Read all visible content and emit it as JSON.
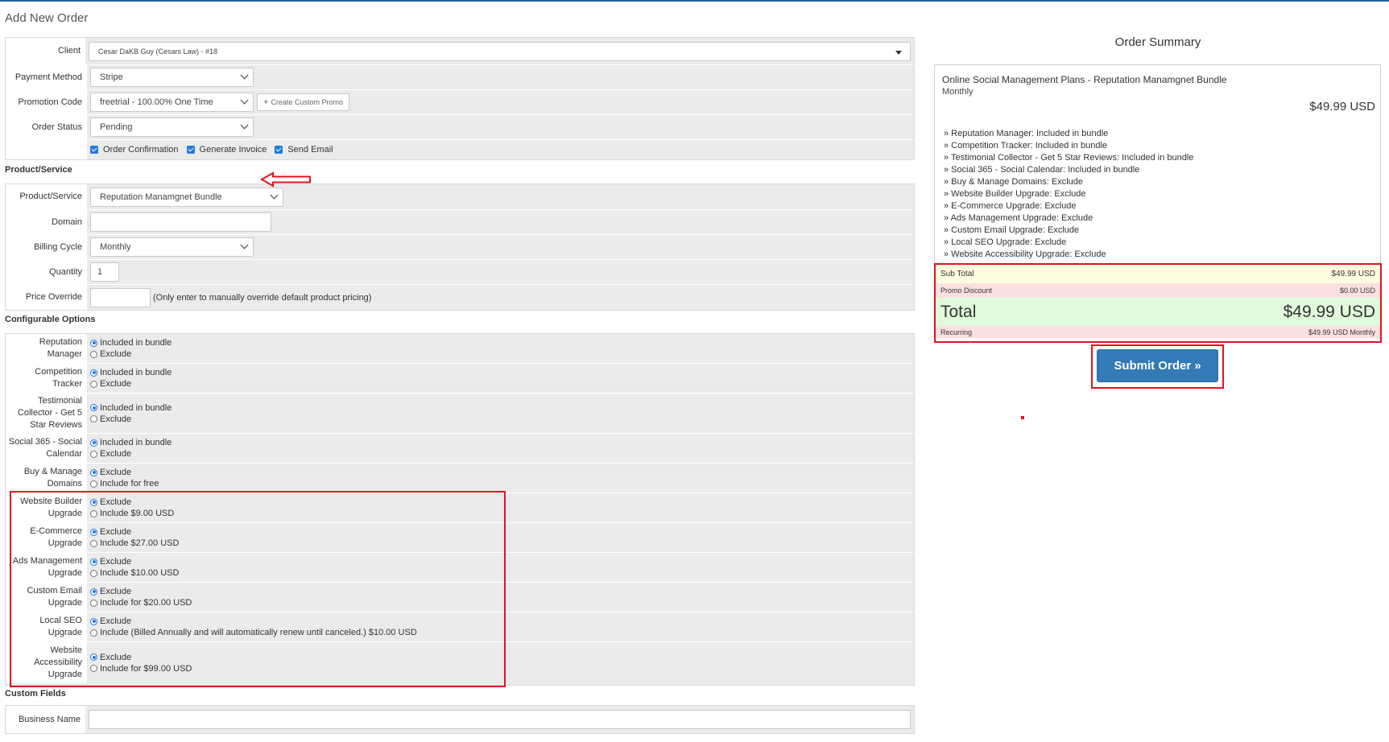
{
  "page": {
    "title": "Add New Order"
  },
  "order": {
    "client_label": "Client",
    "client_value": "Cesar DaKB Guy (Cesars Law) - #18",
    "payment_method_label": "Payment Method",
    "payment_method_value": "Stripe",
    "promotion_code_label": "Promotion Code",
    "promotion_code_value": "freetrial - 100.00% One Time",
    "create_promo_label": "Create Custom Promo",
    "order_status_label": "Order Status",
    "order_status_value": "Pending",
    "checkboxes": {
      "order_confirmation": "Order Confirmation",
      "generate_invoice": "Generate Invoice",
      "send_email": "Send Email"
    }
  },
  "product_section": {
    "title": "Product/Service",
    "product_label": "Product/Service",
    "product_value": "Reputation Manamgnet Bundle",
    "domain_label": "Domain",
    "domain_value": "",
    "billing_cycle_label": "Billing Cycle",
    "billing_cycle_value": "Monthly",
    "quantity_label": "Quantity",
    "quantity_value": "1",
    "price_override_label": "Price Override",
    "price_override_value": "",
    "price_override_help": "(Only enter to manually override default product pricing)"
  },
  "configurable": {
    "title": "Configurable Options",
    "options": [
      {
        "label": "Reputation Manager",
        "choices": [
          "Included in bundle",
          "Exclude"
        ],
        "selected": 0
      },
      {
        "label": "Competition Tracker",
        "choices": [
          "Included in bundle",
          "Exclude"
        ],
        "selected": 0
      },
      {
        "label": "Testimonial Collector - Get 5 Star Reviews",
        "choices": [
          "Included in bundle",
          "Exclude"
        ],
        "selected": 0
      },
      {
        "label": "Social 365 - Social Calendar",
        "choices": [
          "Included in bundle",
          "Exclude"
        ],
        "selected": 0
      },
      {
        "label": "Buy & Manage Domains",
        "choices": [
          "Exclude",
          "Include for free"
        ],
        "selected": 0
      },
      {
        "label": "Website Builder Upgrade",
        "choices": [
          "Exclude",
          "Include $9.00 USD"
        ],
        "selected": 0
      },
      {
        "label": "E-Commerce Upgrade",
        "choices": [
          "Exclude",
          "Include $27.00 USD"
        ],
        "selected": 0
      },
      {
        "label": "Ads Management Upgrade",
        "choices": [
          "Exclude",
          "Include $10.00 USD"
        ],
        "selected": 0
      },
      {
        "label": "Custom Email Upgrade",
        "choices": [
          "Exclude",
          "Include for $20.00 USD"
        ],
        "selected": 0
      },
      {
        "label": "Local SEO Upgrade",
        "choices": [
          "Exclude",
          "Include (Billed Annually and will automatically renew until canceled.) $10.00 USD"
        ],
        "selected": 0
      },
      {
        "label": "Website Accessibility Upgrade",
        "choices": [
          "Exclude",
          "Include for $99.00 USD"
        ],
        "selected": 0
      }
    ]
  },
  "custom_fields": {
    "title": "Custom Fields",
    "business_name_label": "Business Name",
    "business_name_value": ""
  },
  "summary": {
    "title": "Order Summary",
    "product_name": "Online Social Management Plans - Reputation Manamgnet Bundle",
    "cycle": "Monthly",
    "price": "$49.99 USD",
    "options": [
      "» Reputation Manager: Included in bundle",
      "» Competition Tracker: Included in bundle",
      "» Testimonial Collector - Get 5 Star Reviews: Included in bundle",
      "» Social 365 - Social Calendar: Included in bundle",
      "» Buy & Manage Domains: Exclude",
      "» Website Builder Upgrade: Exclude",
      "» E-Commerce Upgrade: Exclude",
      "» Ads Management Upgrade: Exclude",
      "» Custom Email Upgrade: Exclude",
      "» Local SEO Upgrade: Exclude",
      "» Website Accessibility Upgrade: Exclude"
    ],
    "subtotal_label": "Sub Total",
    "subtotal_value": "$49.99 USD",
    "promo_label": "Promo Discount",
    "promo_value": "$0.00 USD",
    "total_label": "Total",
    "total_value": "$49.99 USD",
    "recurring_label": "Recurring",
    "recurring_value": "$49.99 USD Monthly",
    "submit_label": "Submit Order »"
  },
  "colors": {
    "accent": "#337ab7",
    "annotation": "#e0151f",
    "checkbox": "#1f7ae0"
  }
}
